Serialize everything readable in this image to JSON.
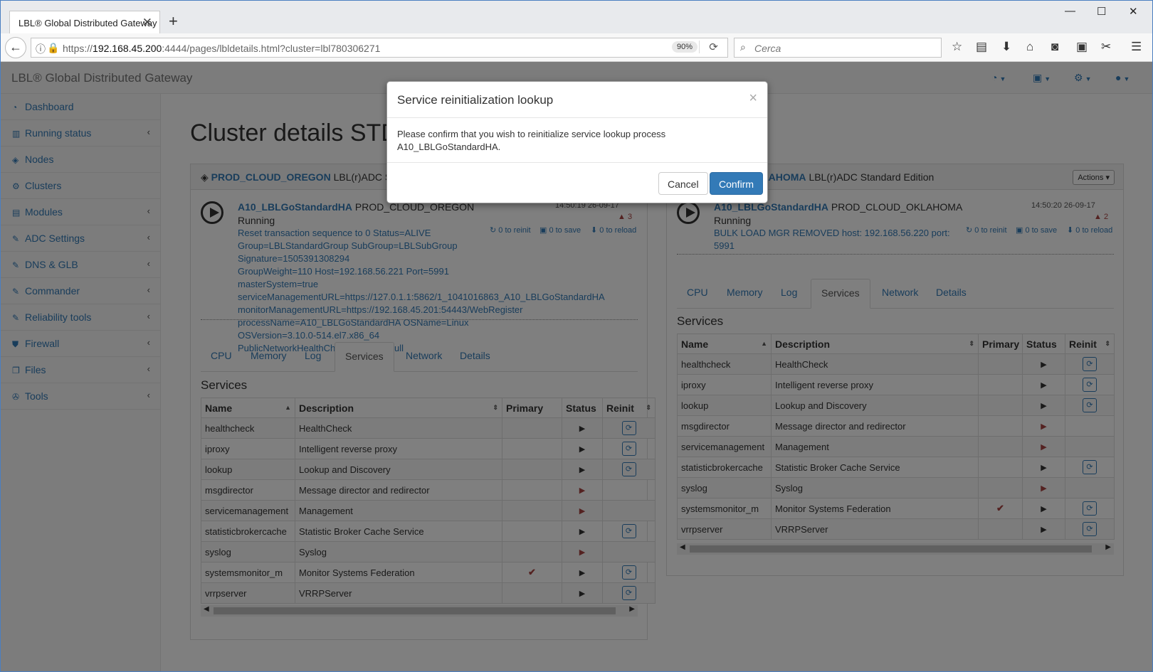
{
  "browser": {
    "tab_title": "LBL® Global Distributed Gateway",
    "url_prefix": "https://",
    "url_host": "192.168.45.200",
    "url_rest": ":4444/pages/lbldetails.html?cluster=lbl780306271",
    "zoom": "90%",
    "search_placeholder": "Cerca"
  },
  "app": {
    "brand": "LBL® Global Distributed Gateway",
    "page_title": "Cluster details STD"
  },
  "sidebar": {
    "items": [
      {
        "label": "Dashboard",
        "icon": "dashboard-icon"
      },
      {
        "label": "Running status",
        "icon": "bar-chart-icon"
      },
      {
        "label": "Nodes",
        "icon": "cube-icon"
      },
      {
        "label": "Clusters",
        "icon": "cogs-icon"
      },
      {
        "label": "Modules",
        "icon": "list-icon"
      },
      {
        "label": "ADC Settings",
        "icon": "edit-icon"
      },
      {
        "label": "DNS & GLB",
        "icon": "edit-icon"
      },
      {
        "label": "Commander",
        "icon": "edit-icon"
      },
      {
        "label": "Reliability tools",
        "icon": "edit-icon"
      },
      {
        "label": "Firewall",
        "icon": "shield-icon"
      },
      {
        "label": "Files",
        "icon": "files-icon"
      },
      {
        "label": "Tools",
        "icon": "wrench-icon"
      }
    ]
  },
  "left_panel": {
    "cluster": "PROD_CLOUD_OREGON",
    "edition": "LBL(r)ADC Sta",
    "process": "A10_LBLGoStandardHA",
    "node": "PROD_CLOUD_OREGON",
    "status": "Running",
    "timestamp": "14:50:19 26-09-17",
    "warnings": "3",
    "reinit": "0 to reinit",
    "save": "0 to save",
    "reload": "0 to reload",
    "message_lines": [
      "Reset transaction sequence to 0 Status=ALIVE",
      "Group=LBLStandardGroup SubGroup=LBLSubGroup Signature=1505391308294",
      "GroupWeight=110 Host=192.168.56.221 Port=5991 masterSystem=true",
      "serviceManagementURL=https://127.0.1.1:5862/1_1041016863_A10_LBLGoStandardHA",
      "monitorManagementURL=https://192.168.45.201:54443/WebRegister",
      "processName=A10_LBLGoStandardHA OSName=Linux OSVersion=3.10.0-514.el7.x86_64",
      "PublicNetworkHealthCheckAddress=null"
    ]
  },
  "right_panel": {
    "cluster": "KLAHOMA",
    "edition": "LBL(r)ADC Standard Edition",
    "actions": "Actions",
    "process": "A10_LBLGoStandardHA",
    "node": "PROD_CLOUD_OKLAHOMA",
    "status": "Running",
    "timestamp": "14:50:20 26-09-17",
    "warnings": "2",
    "reinit": "0 to reinit",
    "save": "0 to save",
    "reload": "0 to reload",
    "message_lines": [
      "BULK LOAD MGR REMOVED host: 192.168.56.220 port:",
      "5991"
    ]
  },
  "tabs": [
    "CPU",
    "Memory",
    "Log",
    "Services",
    "Network",
    "Details"
  ],
  "services_title": "Services",
  "table_headers": {
    "name": "Name",
    "description": "Description",
    "primary": "Primary",
    "status": "Status",
    "reinit": "Reinit"
  },
  "services": [
    {
      "name": "healthcheck",
      "description": "HealthCheck",
      "status": "running",
      "reinit": true,
      "primary": false
    },
    {
      "name": "iproxy",
      "description": "Intelligent reverse proxy",
      "status": "running",
      "reinit": true,
      "primary": false
    },
    {
      "name": "lookup",
      "description": "Lookup and Discovery",
      "status": "running",
      "reinit": true,
      "primary": false
    },
    {
      "name": "msgdirector",
      "description": "Message director and redirector",
      "status": "stopped",
      "reinit": false,
      "primary": false
    },
    {
      "name": "servicemanagement",
      "description": "Management",
      "status": "stopped",
      "reinit": false,
      "primary": false
    },
    {
      "name": "statisticbrokercache",
      "description": "Statistic Broker Cache Service",
      "status": "running",
      "reinit": true,
      "primary": false
    },
    {
      "name": "syslog",
      "description": "Syslog",
      "status": "stopped",
      "reinit": false,
      "primary": false
    },
    {
      "name": "systemsmonitor_m",
      "description": "Monitor Systems Federation",
      "status": "running",
      "reinit": true,
      "primary": true
    },
    {
      "name": "vrrpserver",
      "description": "VRRPServer",
      "status": "running",
      "reinit": true,
      "primary": false
    }
  ],
  "modal": {
    "title": "Service reinitialization lookup",
    "close": "×",
    "body_line1": "Please confirm that you wish to reinitialize service lookup process",
    "body_line2": "A10_LBLGoStandardHA.",
    "cancel": "Cancel",
    "confirm": "Confirm"
  },
  "colors": {
    "link": "#337ab7",
    "stopped": "#a94442",
    "primary_btn": "#337ab7"
  }
}
